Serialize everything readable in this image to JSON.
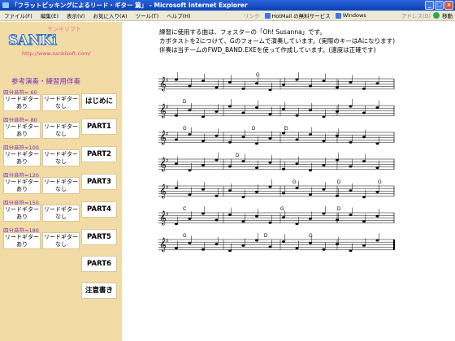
{
  "window": {
    "title": "「フラットピッキングによるリード・ギター 篇」 - Microsoft Internet Explorer",
    "controls": [
      "_",
      "□",
      "×"
    ]
  },
  "menubar": {
    "items": [
      "ファイル(F)",
      "編集(E)",
      "表示(V)",
      "お気に入り(A)",
      "ツール(T)",
      "ヘルプ(H)"
    ],
    "links_label": "リンク",
    "links": [
      "HotMail の無料サービス",
      "Windows"
    ],
    "address_label": "アドレス(D)",
    "go_label": "移動"
  },
  "sidebar": {
    "logo_kana": "サンキソフト",
    "logo_text": "SANKi",
    "logo_url": "http://www.sankisoft.com/",
    "section_title": "参考演奏・練習用伴奏",
    "groups": [
      {
        "label": "四分音符= 60",
        "with": "リードギター\nあり",
        "without": "リードギター\nなし"
      },
      {
        "label": "四分音符= 80",
        "with": "リードギター\nあり",
        "without": "リードギター\nなし"
      },
      {
        "label": "四分音符=100",
        "with": "リードギター\nあり",
        "without": "リードギター\nなし"
      },
      {
        "label": "四分音符=120",
        "with": "リードギター\nあり",
        "without": "リードギター\nなし"
      },
      {
        "label": "四分音符=150",
        "with": "リードギター\nあり",
        "without": "リードギター\nなし"
      },
      {
        "label": "四分音符=180",
        "with": "リードギター\nあり",
        "without": "リードギター\nなし"
      }
    ],
    "parts": [
      "はじめに",
      "PART1",
      "PART2",
      "PART3",
      "PART4",
      "PART5",
      "PART6",
      "注意書き"
    ]
  },
  "content": {
    "intro_lines": [
      "練習に使用する曲は、フォスターの「Oh! Susanna」です。",
      "カポタストを2につけて、Gのフォームで演奏しています。(実際のキーはAになります)",
      "伴奏は当チームのFWD_BAND.EXEを使って作成しています。(速度は正確です)"
    ],
    "score": {
      "staves": [
        {
          "chords": [
            "G"
          ]
        },
        {
          "chords": [
            "D"
          ]
        },
        {
          "chords": [
            "G",
            "D",
            "G"
          ]
        },
        {
          "chords": [
            "D"
          ]
        },
        {
          "chords": [
            "G",
            "D",
            "G"
          ]
        },
        {
          "chords": [
            "C",
            "G",
            "D"
          ]
        },
        {
          "chords": [
            "G",
            "D",
            "G"
          ]
        }
      ]
    }
  }
}
